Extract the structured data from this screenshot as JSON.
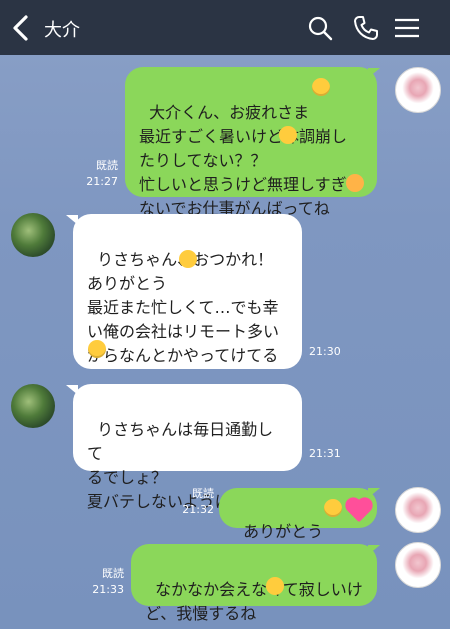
{
  "header": {
    "title": "大介"
  },
  "icons": {
    "back": "chevron-left-icon",
    "search": "search-icon",
    "call": "phone-icon",
    "menu": "hamburger-menu-icon"
  },
  "colors": {
    "header_bg": "#2b3444",
    "chat_bg": "#7f97c1",
    "my_bubble": "#8bd75a",
    "their_bubble": "#ffffff"
  },
  "messages": [
    {
      "sender": "me",
      "text": "大介くん、お疲れさま\n最近すごく暑いけど体調崩し\nたりしてない？？\n忙しいと思うけど無理しすぎ\nないでお仕事がんばってね",
      "read": "既読",
      "time": "21:27"
    },
    {
      "sender": "them",
      "text": "りさちゃん、おつかれ！\nありがとう\n最近また忙しくて…でも幸\nい俺の会社はリモート多い\nからなんとかやってけてる\n",
      "time": "21:30"
    },
    {
      "sender": "them",
      "text": "りさちゃんは毎日通勤して\nるでしょ？\n夏バテしないようにね！",
      "time": "21:31"
    },
    {
      "sender": "me",
      "text": "ありがとう",
      "read": "既読",
      "time": "21:32"
    },
    {
      "sender": "me",
      "text": "なかなか会えなくて寂しいけ\nど、我慢するね",
      "read": "既読",
      "time": "21:33"
    }
  ]
}
